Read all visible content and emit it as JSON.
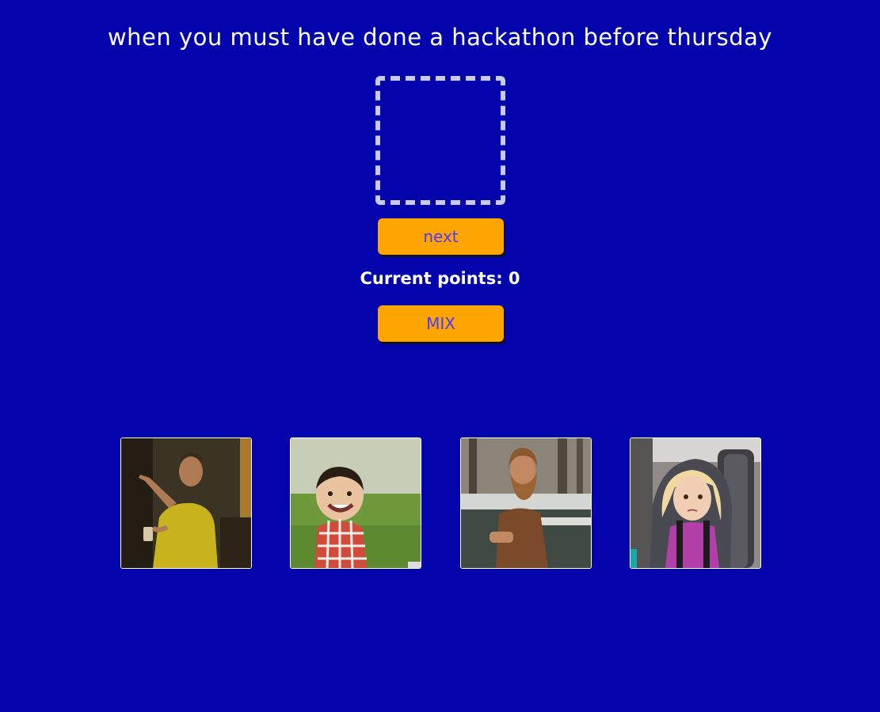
{
  "prompt": {
    "text": "when you must have done a hackathon before thursday"
  },
  "answer_slot": {
    "icon": "empty-dropzone"
  },
  "buttons": {
    "next_label": "next",
    "mix_label": "MIX"
  },
  "score": {
    "label": "Current points: 0"
  },
  "colors": {
    "background": "#0404ad",
    "button": "#ffa500",
    "button_text": "#4a3aff",
    "dropzone_border": "#c8c9ec"
  },
  "memes": [
    {
      "icon": "meme-image-man-pointing"
    },
    {
      "icon": "meme-image-evil-toddler"
    },
    {
      "icon": "meme-image-bearded-man-nodding"
    },
    {
      "icon": "meme-image-side-eye-girl"
    }
  ]
}
